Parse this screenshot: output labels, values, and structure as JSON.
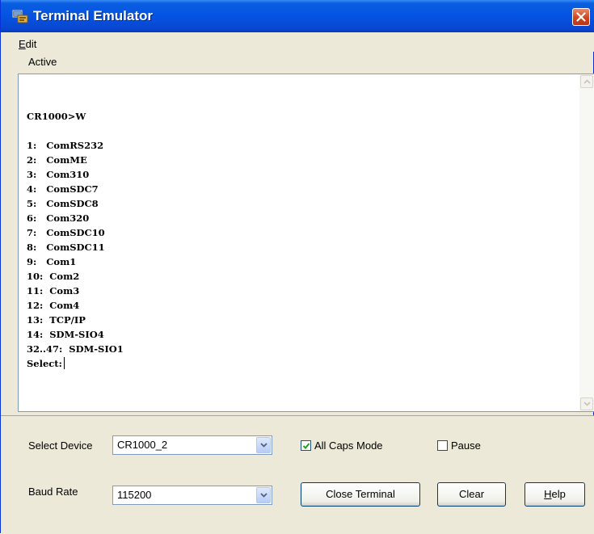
{
  "window": {
    "title": "Terminal Emulator"
  },
  "menu": {
    "edit_prefix": "E",
    "edit_rest": "dit"
  },
  "status": {
    "label": "Active"
  },
  "terminal": {
    "lines": [
      "",
      "CR1000>W",
      "",
      "1:   ComRS232",
      "2:   ComME",
      "3:   Com310",
      "4:   ComSDC7",
      "5:   ComSDC8",
      "6:   Com320",
      "7:   ComSDC10",
      "8:   ComSDC11",
      "9:   Com1",
      "10:  Com2",
      "11:  Com3",
      "12:  Com4",
      "13:  TCP/IP",
      "14:  SDM-SIO4",
      "32..47:  SDM-SIO1"
    ],
    "prompt": "Select:"
  },
  "controls": {
    "select_device_label": "Select Device",
    "select_device_value": "CR1000_2",
    "all_caps_label": "All Caps Mode",
    "all_caps_checked": true,
    "pause_label": "Pause",
    "pause_checked": false,
    "baud_rate_label": "Baud Rate",
    "baud_rate_value": "115200",
    "close_terminal_label": "Close Terminal",
    "clear_label": "Clear",
    "help_prefix": "H",
    "help_rest": "elp"
  },
  "icons": {
    "app": "terminal-app-icon",
    "close": "close-icon",
    "scroll_up": "scroll-up-arrow-icon",
    "scroll_down": "scroll-down-arrow-icon",
    "dropdown": "chevron-down-icon",
    "check": "checkmark-icon"
  },
  "colors": {
    "titlebar": "#0453e3",
    "close_button": "#d2451f",
    "window_face": "#ece9d8",
    "terminal_bg": "#ffffff"
  }
}
